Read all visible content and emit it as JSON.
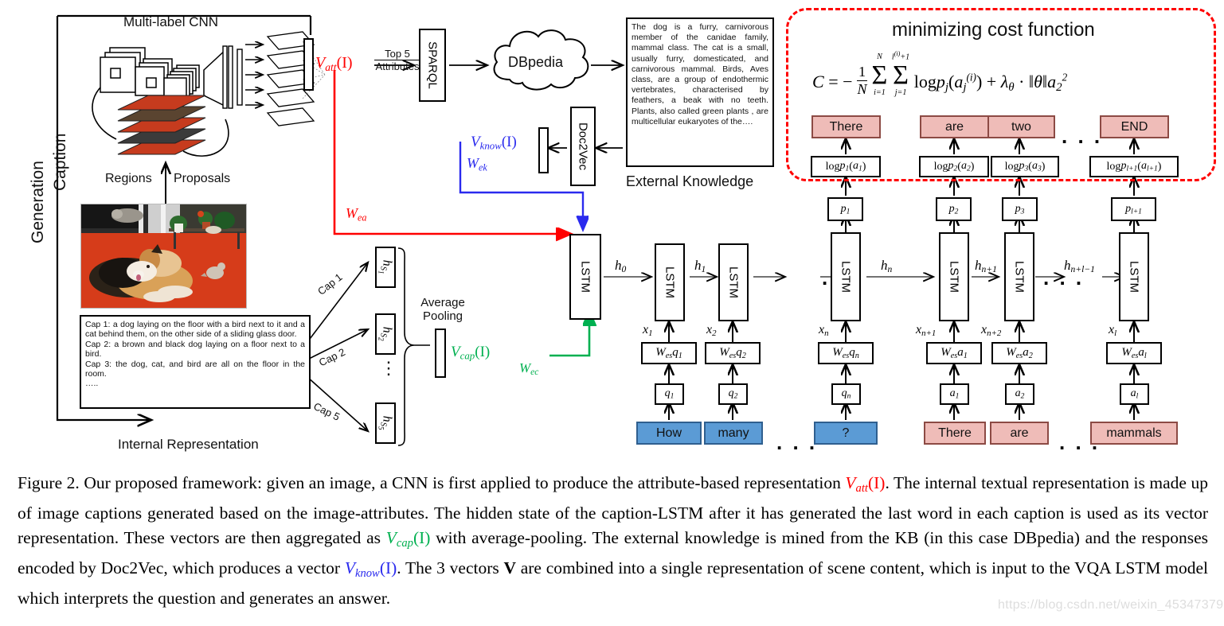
{
  "figure": {
    "label": "Figure 2.",
    "caption_parts": {
      "p1": "Figure 2. Our proposed framework: given an image, a CNN is first applied to produce the attribute-based representation ",
      "v_att": "V",
      "v_att_sub": "att",
      "v_att_arg": "(I)",
      "p2": ". The internal textual representation is made up of image captions generated based on the image-attributes. The hidden state of the caption-LSTM after it has generated the last word in each caption is used as its vector representation. These vectors are then aggregated as ",
      "v_cap": "V",
      "v_cap_sub": "cap",
      "v_cap_arg": "(I)",
      "p3": " with average-pooling. The external knowledge is mined from the KB (in this case DBpedia) and the responses encoded by Doc2Vec, which produces a vector ",
      "v_know": "V",
      "v_know_sub": "know",
      "v_know_arg": "(I)",
      "p4": ". The 3 vectors ",
      "vbold": "V",
      "p5": " are combined into a single representation of scene content, which is input to the VQA LSTM model which interprets the question and generates an answer."
    }
  },
  "watermark": "https://blog.csdn.net/weixin_45347379",
  "left_panel": {
    "side_label_outer": "Generation",
    "side_label_inner": "Caption",
    "cnn_title": "Multi-label CNN",
    "regions_label": "Regions",
    "proposals_label": "Proposals",
    "internal_rep_label": "Internal Representation",
    "captions_text": "Cap 1: a dog laying on the floor with a bird next to it and a cat behind them, on the other side of a sliding glass door.\nCap 2: a brown and black dog laying on a floor next to a bird.\nCap 3: the dog, cat, and bird are all on the floor in the room.\n…..",
    "cap_arrows": [
      "Cap 1",
      "Cap 2",
      "Cap 5"
    ],
    "hs_boxes": [
      "h",
      "h",
      "h"
    ],
    "hs_subs": [
      "S1",
      "S2",
      "S5"
    ],
    "average_pooling_label": "Average\nPooling",
    "average_pooling_line1": "Average",
    "average_pooling_line2": "Pooling"
  },
  "knowledge_path": {
    "v_att_label": "V",
    "v_att_sub": "att",
    "v_att_arg": "(I)",
    "top5_line1": "Top 5",
    "top5_line2": "Attributes",
    "sparql_label": "SPARQL",
    "dbpedia_label": "DBpedia",
    "doc2vec_label": "Doc2Vec",
    "external_knowledge_title": "External Knowledge",
    "external_knowledge_text": "The dog is a furry, carnivorous member of the canidae family, mammal class. The cat is a small, usually furry, domesticated, and carnivorous mammal. Birds, Aves class, are a group of endothermic vertebrates, characterised by feathers, a beak with no teeth. Plants, also called green plants , are multicellular eukaryotes of the….",
    "v_know_label": "V",
    "v_know_sub": "know",
    "v_know_arg": "(I)",
    "w_ek_label": "W",
    "w_ek_sub": "ek",
    "w_ea_label": "W",
    "w_ea_sub": "ea",
    "v_cap_label": "V",
    "v_cap_sub": "cap",
    "v_cap_arg": "(I)",
    "w_ec_label": "W",
    "w_ec_sub": "ec"
  },
  "cost_box": {
    "title": "minimizing cost function",
    "equation": "C = -1/N Σ_{i=1}^{N} Σ_{j=1}^{l^{(i)}+1} log p_j(a_j^{(i)}) + λ_θ · ||θ||a_2^2",
    "eq_C": "C",
    "eq_eq": "=",
    "eq_minus": "−",
    "eq_frac_num": "1",
    "eq_frac_den": "N",
    "eq_sum1_top": "N",
    "eq_sum1_bot": "i=1",
    "eq_sum2_top": "l(i)+1",
    "eq_sum2_bot": "j=1",
    "eq_log": "log",
    "eq_p": "p",
    "eq_tail": "+ λθ · ‖θ‖a22"
  },
  "vqa": {
    "fusion_lstm_label": "LSTM",
    "h0_label": "h",
    "h0_sub": "0",
    "question_words": [
      "How",
      "many",
      "?"
    ],
    "answer_words": [
      "There",
      "are",
      "mammals"
    ],
    "output_words": [
      "There",
      "are",
      "two",
      "END"
    ],
    "q_lstm_labels": [
      "LSTM",
      "LSTM",
      "LSTM"
    ],
    "a_lstm_labels": [
      "LSTM",
      "LSTM",
      "LSTM"
    ],
    "q_embed": [
      "Wesq1",
      "Wesq2",
      "Wesqn"
    ],
    "q_tokens": [
      "q1",
      "q2",
      "qn"
    ],
    "a_embed": [
      "Wesa1",
      "Wesa2",
      "Wesal"
    ],
    "a_tokens": [
      "a1",
      "a2",
      "al"
    ],
    "x_labels": [
      "x1",
      "x2",
      "xn",
      "xn+1",
      "xn+2",
      "xl"
    ],
    "h_labels": [
      "h0",
      "h1",
      "hn",
      "hn+1",
      "hn+l-1"
    ],
    "p_boxes": [
      "p1",
      "p2",
      "p3",
      "pl+1"
    ],
    "logp_boxes": [
      "log p1(a1)",
      "log p2(a2)",
      "log p3(a3)",
      "log pl+1(al+1)"
    ],
    "ellipsis": ". . ."
  },
  "colors": {
    "attribute_red": "#FF0000",
    "caption_green": "#00B050",
    "knowledge_blue": "#2A2AEE",
    "question_blue": "#5B9BD5",
    "answer_pink": "#EFBCB8",
    "dash_red": "#FF0000"
  }
}
